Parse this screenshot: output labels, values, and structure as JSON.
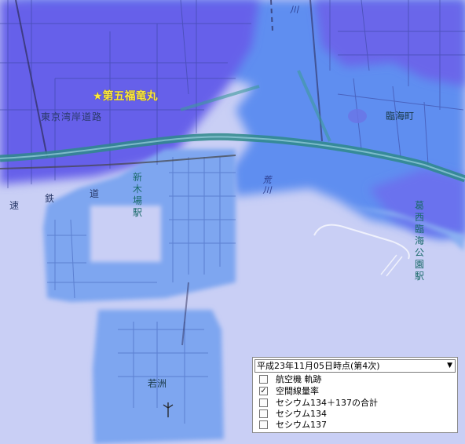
{
  "map": {
    "labels": {
      "landmark": "★第五福竜丸",
      "expressway": "東京湾岸道路",
      "railway": [
        "速",
        "鉄",
        "道"
      ],
      "shinkiba_station": [
        "新",
        "木",
        "場",
        "駅"
      ],
      "rinkai_town": "臨海町",
      "arakawa_north": "川",
      "arakawa_mid": [
        "荒",
        "川"
      ],
      "kasai_station": [
        "葛",
        "西",
        "臨",
        "海",
        "公",
        "園",
        "駅"
      ],
      "wakasu": "若洲"
    },
    "colors": {
      "sea": "#c9cff5",
      "high_dose": "#6a64ee",
      "mid_dose": "#5a8af0",
      "low_dose": "#8ab2f2",
      "expressway": "#2f8a8a"
    }
  },
  "layer_panel": {
    "selected_date": "平成23年11月05日時点(第4次)",
    "options": [
      {
        "label": "航空機 軌跡",
        "checked": false
      },
      {
        "label": "空間線量率",
        "checked": true
      },
      {
        "label": "セシウム134＋137の合計",
        "checked": false
      },
      {
        "label": "セシウム134",
        "checked": false
      },
      {
        "label": "セシウム137",
        "checked": false
      }
    ]
  }
}
